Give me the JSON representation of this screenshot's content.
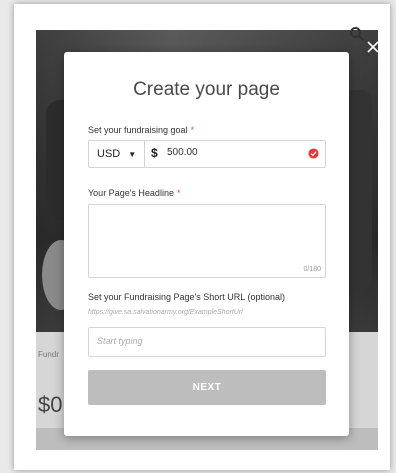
{
  "modal": {
    "title": "Create your page",
    "goal": {
      "label": "Set your fundraising goal",
      "required_mark": "*",
      "currency": "USD",
      "currency_symbol": "$",
      "amount": "500.00"
    },
    "headline": {
      "label": "Your Page's Headline",
      "required_mark": "*",
      "counter": "0/180"
    },
    "short_url": {
      "label": "Set your Fundraising Page's Short URL (optional)",
      "hint": "https://give.sa.salvationarmy.org/ExampleShortUrl",
      "placeholder": "Start typing"
    },
    "next_label": "NEXT"
  },
  "background": {
    "fund_label": "Fundr",
    "amount": "$0"
  },
  "colors": {
    "required": "#d9534f",
    "button_disabled": "#bdbdbd",
    "warning_icon": "#e53935"
  }
}
